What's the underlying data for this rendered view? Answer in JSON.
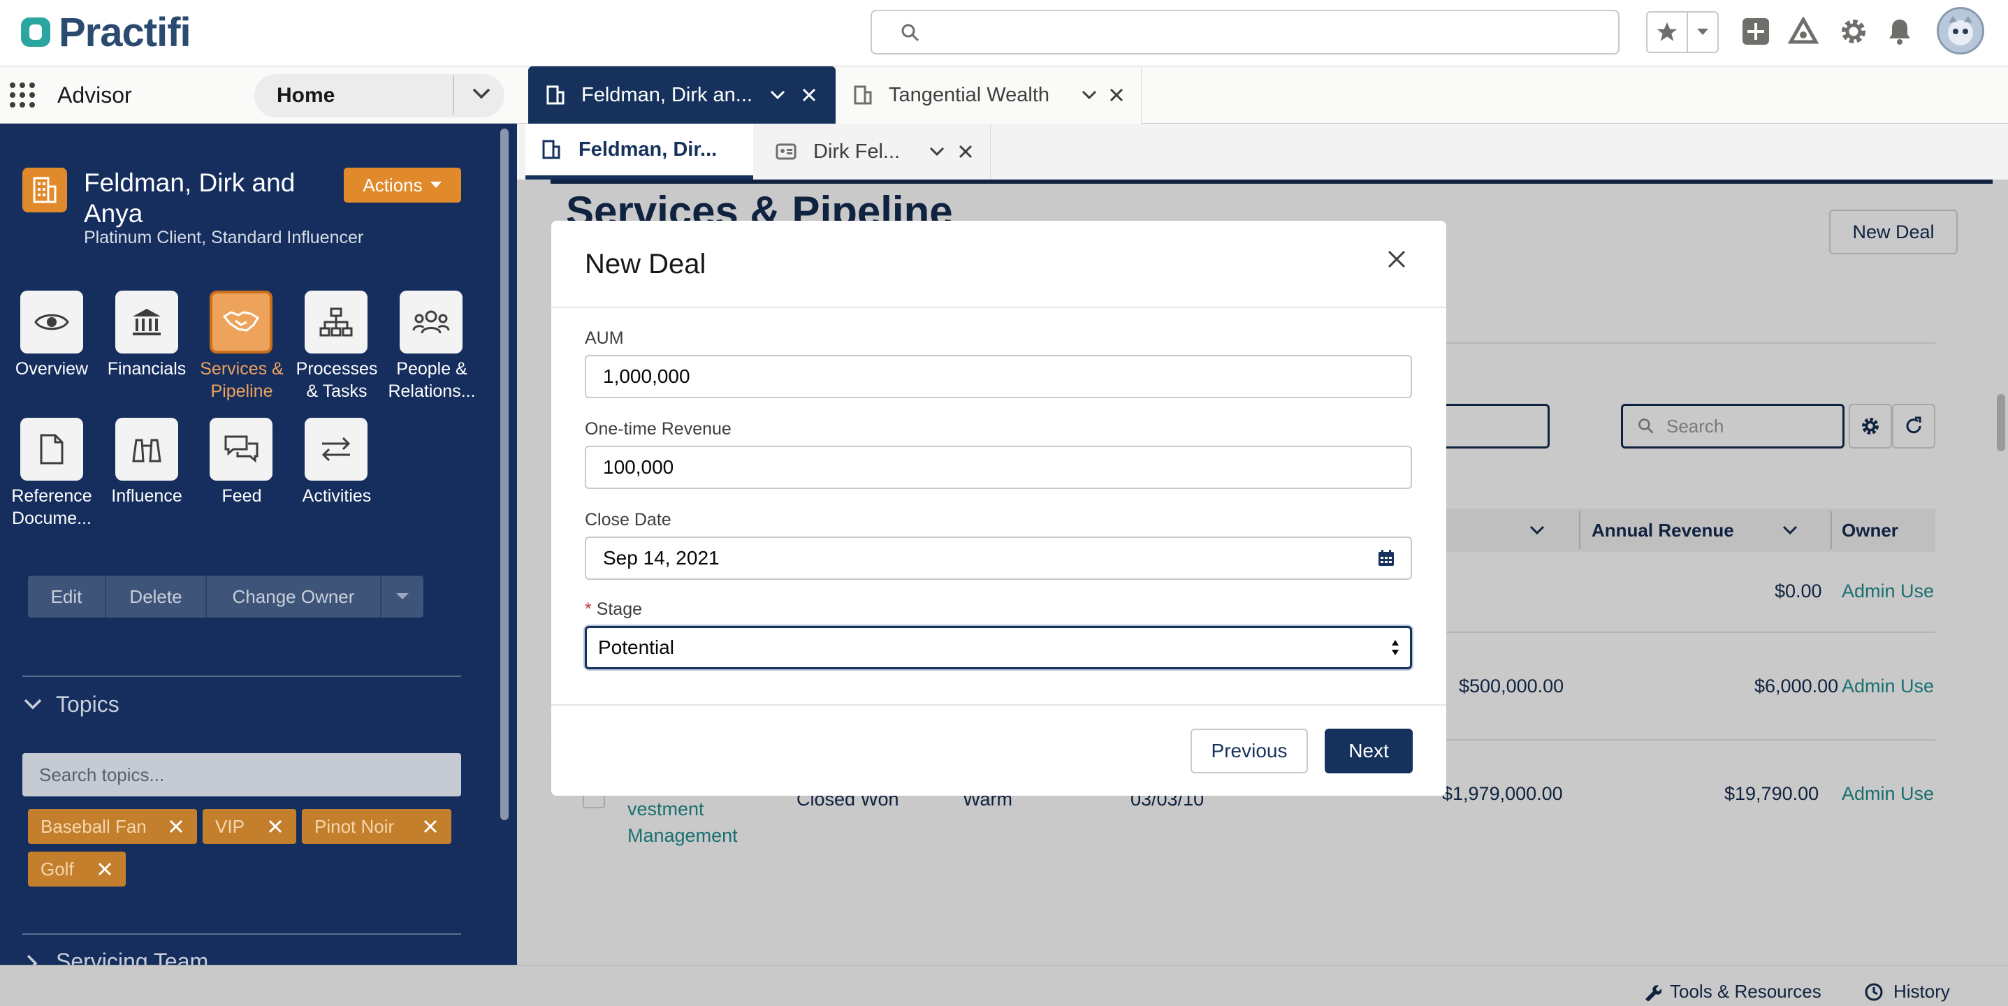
{
  "header": {
    "logo_text": "Practifi",
    "search_placeholder": ""
  },
  "nav": {
    "app_name": "Advisor",
    "home_label": "Home",
    "tabs": [
      {
        "label": "Feldman, Dirk an..."
      },
      {
        "label": "Tangential Wealth"
      }
    ],
    "subtabs": [
      {
        "label": "Feldman, Dir..."
      },
      {
        "label": "Dirk Fel..."
      }
    ]
  },
  "sidebar": {
    "record_name": "Feldman, Dirk and Anya",
    "record_name_line1": "Feldman, Dirk and",
    "record_name_line2": "Anya",
    "record_subtitle": "Platinum Client, Standard Influencer",
    "actions_label": "Actions",
    "tiles": [
      {
        "l1": "Overview",
        "l2": "",
        "icon": "eye-icon"
      },
      {
        "l1": "Financials",
        "l2": "",
        "icon": "bank-icon"
      },
      {
        "l1": "Services &",
        "l2": "Pipeline",
        "icon": "handshake-icon"
      },
      {
        "l1": "Processes",
        "l2": "& Tasks",
        "icon": "hierarchy-icon"
      },
      {
        "l1": "People &",
        "l2": "Relations...",
        "icon": "people-icon"
      },
      {
        "l1": "Reference",
        "l2": "Docume...",
        "icon": "document-icon"
      },
      {
        "l1": "Influence",
        "l2": "",
        "icon": "binoculars-icon"
      },
      {
        "l1": "Feed",
        "l2": "",
        "icon": "chat-icon"
      },
      {
        "l1": "Activities",
        "l2": "",
        "icon": "swap-icon"
      }
    ],
    "buttons": {
      "edit": "Edit",
      "delete": "Delete",
      "change_owner": "Change Owner"
    },
    "topics_title": "Topics",
    "topics_search_placeholder": "Search topics...",
    "topics": [
      "Baseball Fan",
      "VIP",
      "Pinot Noir",
      "Golf"
    ],
    "servicing_team": "Servicing Team"
  },
  "main": {
    "page_title": "Services & Pipeline",
    "new_deal_button": "New Deal",
    "search_placeholder": "Search",
    "columns": [
      "Annual Revenue",
      "Owner"
    ],
    "rows": [
      {
        "name": "",
        "stage": "",
        "temp": "",
        "date": "",
        "aum": "",
        "revenue": "$0.00",
        "owner": "Admin Use"
      },
      {
        "name": "",
        "stage": "",
        "temp": "",
        "date": "",
        "aum": "$500,000.00",
        "revenue": "$6,000.00",
        "owner": "Admin Use"
      },
      {
        "name": "vestment Management",
        "name_l1": "vestment",
        "name_l2": "Management",
        "stage": "Closed Won",
        "temp": "Warm",
        "date": "03/03/10",
        "aum": "$1,979,000.00",
        "revenue": "$19,790.00",
        "owner": "Admin Use"
      }
    ]
  },
  "footer": {
    "tools": "Tools & Resources",
    "history": "History"
  },
  "modal": {
    "title": "New Deal",
    "fields": {
      "aum": {
        "label": "AUM",
        "value": "1,000,000"
      },
      "one_time_revenue": {
        "label": "One-time Revenue",
        "value": "100,000"
      },
      "close_date": {
        "label": "Close Date",
        "value": "Sep 14, 2021"
      },
      "stage": {
        "label": "Stage",
        "required_mark": "*",
        "value": "Potential"
      }
    },
    "previous_label": "Previous",
    "next_label": "Next"
  }
}
